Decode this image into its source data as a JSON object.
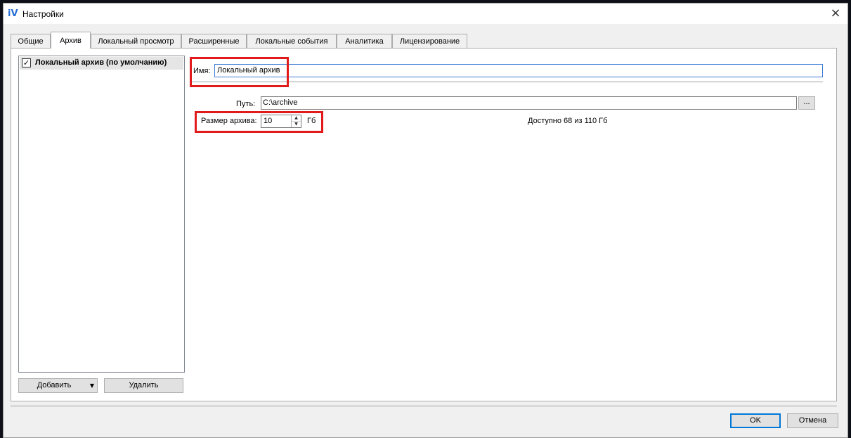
{
  "window": {
    "title": "Настройки",
    "app_icon_text": "iV",
    "close_glyph": "×"
  },
  "tabs": [
    {
      "label": "Общие",
      "active": false
    },
    {
      "label": "Архив",
      "active": true
    },
    {
      "label": "Локальный просмотр",
      "active": false
    },
    {
      "label": "Расширенные",
      "active": false
    },
    {
      "label": "Локальные события",
      "active": false
    },
    {
      "label": "Аналитика",
      "active": false
    },
    {
      "label": "Лицензирование",
      "active": false
    }
  ],
  "archive_list": {
    "items": [
      {
        "label": "Локальный архив (по умолчанию)",
        "checked": true
      }
    ],
    "add_label": "Добавить",
    "delete_label": "Удалить"
  },
  "form": {
    "name_label": "Имя:",
    "name_value": "Локальный архив",
    "path_label": "Путь:",
    "path_value": "C:\\archive",
    "browse_label": "...",
    "size_label": "Размер архива:",
    "size_value": "10",
    "size_unit": "Гб",
    "available_text": "Доступно 68 из 110 Гб"
  },
  "dialog_buttons": {
    "ok_label": "OK",
    "cancel_label": "Отмена"
  },
  "colors": {
    "highlight_box": "#e11b1b",
    "focus_border": "#0078d7"
  }
}
